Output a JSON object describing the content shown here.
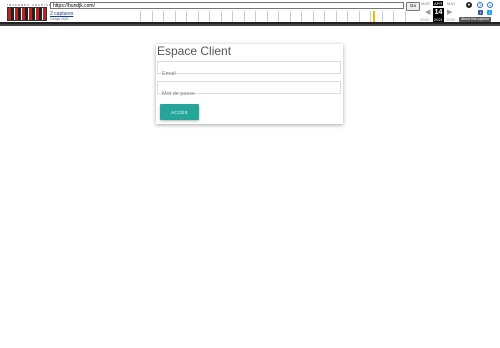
{
  "wayback": {
    "logo_top": "INTERNET ARCHIVE",
    "logo_label": "Wayback Machine",
    "url": "https://bundjk.com/",
    "go_label": "Go",
    "captures_label": "2 captures",
    "capture_range": "14 Apr 2021",
    "months": {
      "prev": "MAR",
      "current": "APR",
      "next": "MAY"
    },
    "day": "14",
    "years": {
      "prev": "2020",
      "current": "2021",
      "next": "2022"
    },
    "about_label": "About this capture",
    "icons": [
      "user-icon",
      "help-icon",
      "close-icon",
      "facebook-icon",
      "twitter-icon"
    ]
  },
  "login": {
    "title": "Espace Client",
    "email_placeholder": "Email",
    "password_placeholder": "Mot de passe",
    "submit_label": "ACCÈS"
  },
  "colors": {
    "accent": "#26a69a",
    "timeline_marker": "#f5b800"
  }
}
